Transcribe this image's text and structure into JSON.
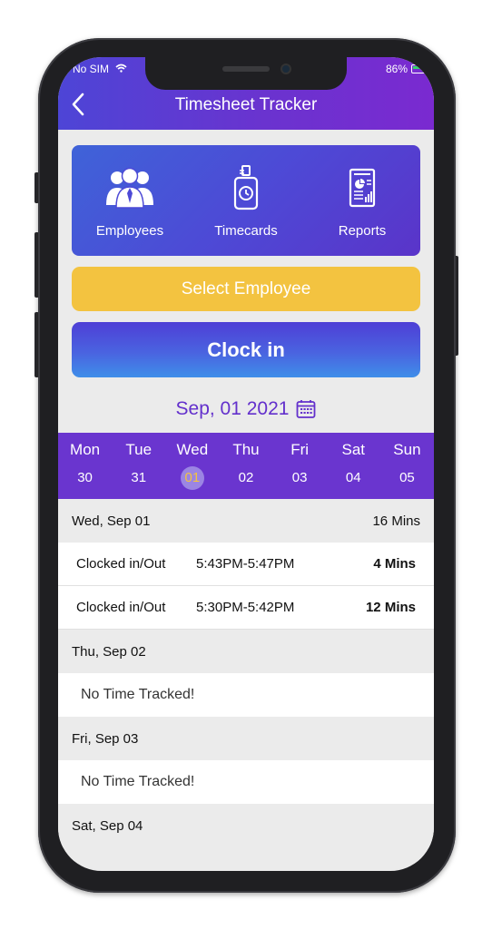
{
  "status": {
    "carrier": "No SIM",
    "battery": "86%"
  },
  "header": {
    "title": "Timesheet Tracker"
  },
  "tiles": [
    {
      "label": "Employees",
      "icon": "employees-icon"
    },
    {
      "label": "Timecards",
      "icon": "timecards-icon"
    },
    {
      "label": "Reports",
      "icon": "reports-icon"
    }
  ],
  "buttons": {
    "select_employee": "Select Employee",
    "clock_in": "Clock in"
  },
  "date_label": "Sep, 01 2021",
  "week": {
    "days": [
      {
        "name": "Mon",
        "num": "30"
      },
      {
        "name": "Tue",
        "num": "31"
      },
      {
        "name": "Wed",
        "num": "01",
        "selected": true
      },
      {
        "name": "Thu",
        "num": "02"
      },
      {
        "name": "Fri",
        "num": "03"
      },
      {
        "name": "Sat",
        "num": "04"
      },
      {
        "name": "Sun",
        "num": "05"
      }
    ]
  },
  "groups": [
    {
      "header": "Wed, Sep 01",
      "total": "16 Mins",
      "entries": [
        {
          "label": "Clocked in/Out",
          "time": "5:43PM-5:47PM",
          "duration": "4 Mins"
        },
        {
          "label": "Clocked in/Out",
          "time": "5:30PM-5:42PM",
          "duration": "12 Mins"
        }
      ]
    },
    {
      "header": "Thu, Sep 02",
      "empty": "No Time Tracked!"
    },
    {
      "header": "Fri, Sep 03",
      "empty": "No Time Tracked!"
    },
    {
      "header": "Sat, Sep 04"
    }
  ],
  "colors": {
    "header": "#6a33cf",
    "accent": "#6330cc",
    "yellow": "#f3c340",
    "selected_day": "#9b85e3"
  }
}
